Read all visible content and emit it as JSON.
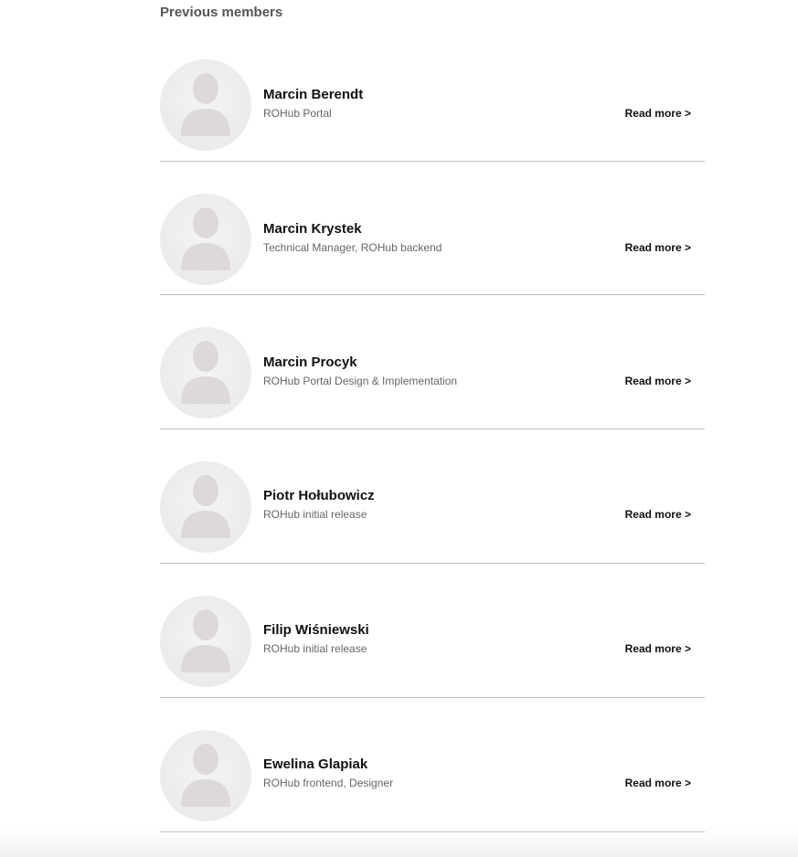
{
  "section": {
    "title": "Previous members"
  },
  "members": [
    {
      "name": "Marcin Berendt",
      "role": "ROHub Portal",
      "link": "Read more >"
    },
    {
      "name": "Marcin Krystek",
      "role": "Technical Manager, ROHub backend",
      "link": "Read more >"
    },
    {
      "name": "Marcin Procyk",
      "role": "ROHub Portal Design & Implementation",
      "link": "Read more >"
    },
    {
      "name": "Piotr Hołubowicz",
      "role": "ROHub initial release",
      "link": "Read more >"
    },
    {
      "name": "Filip Wiśniewski",
      "role": "ROHub initial release",
      "link": "Read more >"
    },
    {
      "name": "Ewelina Glapiak",
      "role": "ROHub frontend, Designer",
      "link": "Read more >"
    }
  ],
  "avatar": {
    "icon": "default-user-avatar-icon",
    "color": "#ddd9d9"
  }
}
